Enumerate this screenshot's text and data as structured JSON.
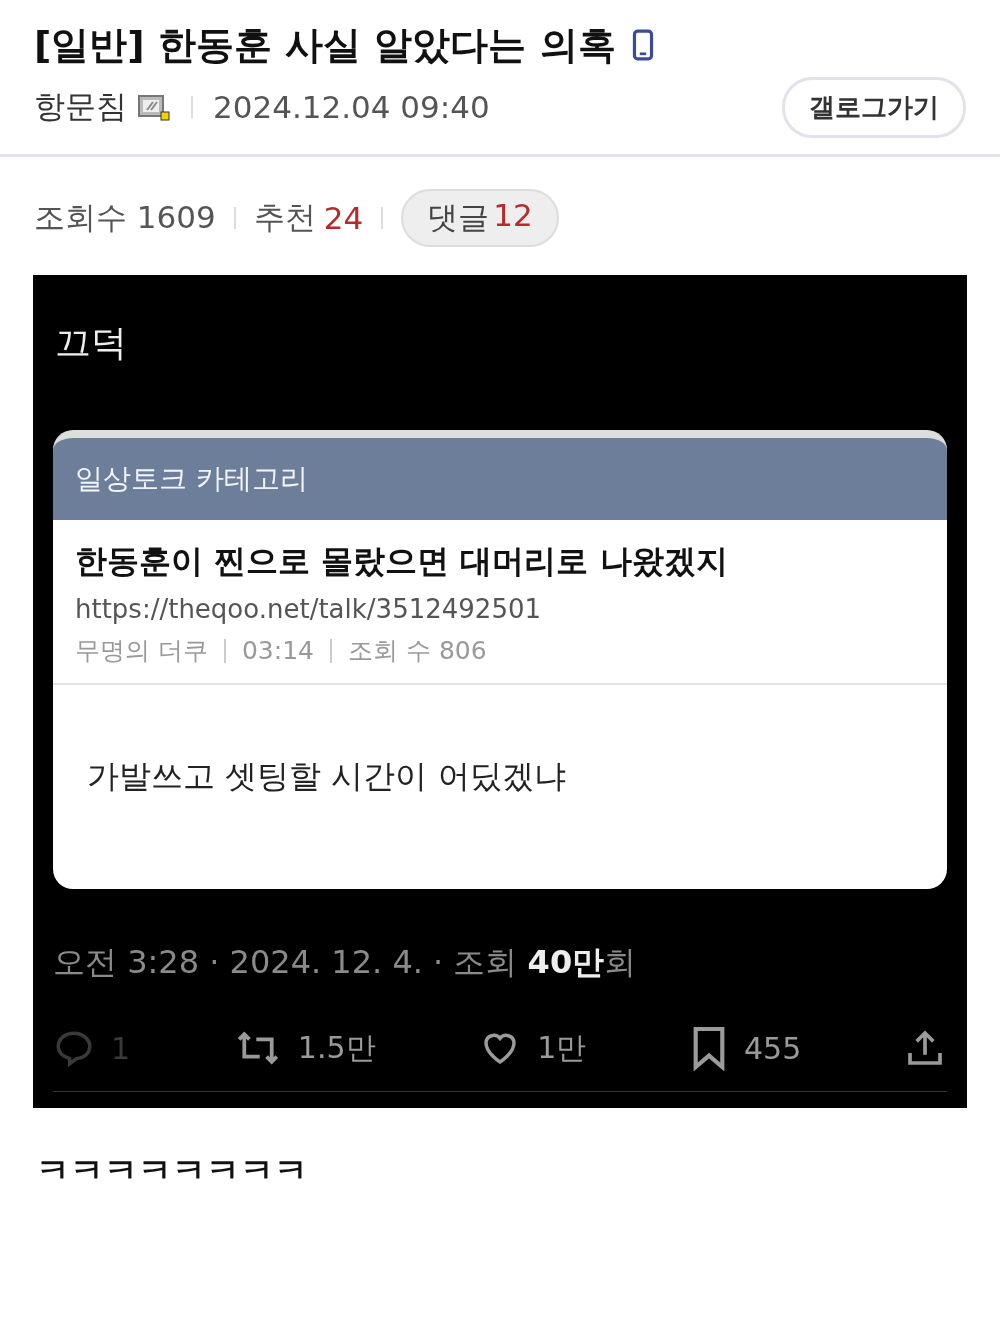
{
  "post": {
    "category": "[일반]",
    "title": "한동훈 사실 알았다는 의혹",
    "author": "항문침",
    "date": "2024.12.04 09:40",
    "gallog_button": "갤로그가기"
  },
  "stats": {
    "views_label": "조회수",
    "views": "1609",
    "recommend_label": "추천",
    "recommend": "24",
    "comments_label": "댓글",
    "comments": "12"
  },
  "tweet": {
    "text": "끄덕",
    "quoted": {
      "category": "일상토크 카테고리",
      "title": "한동훈이 찐으로 몰랐으면 대머리로 나왔겠지",
      "url": "https://theqoo.net/talk/3512492501",
      "meta": [
        "무명의 더쿠",
        "03:14",
        "조회 수 806"
      ],
      "body": "가발쓰고 셋팅할 시간이 어딨겠냐"
    },
    "timestamp": "오전 3:28 · 2024. 12. 4. · 조회 **40만**회",
    "actions": [
      {
        "kind": "reply",
        "count": "1",
        "disabled": true
      },
      {
        "kind": "retweet",
        "count": "1.5만",
        "disabled": false
      },
      {
        "kind": "like",
        "count": "1만",
        "disabled": false
      },
      {
        "kind": "bookmark",
        "count": "455",
        "disabled": false
      },
      {
        "kind": "share",
        "disabled": false
      }
    ]
  },
  "body_text": "ㅋㅋㅋㅋㅋㅋㅋㅋ"
}
